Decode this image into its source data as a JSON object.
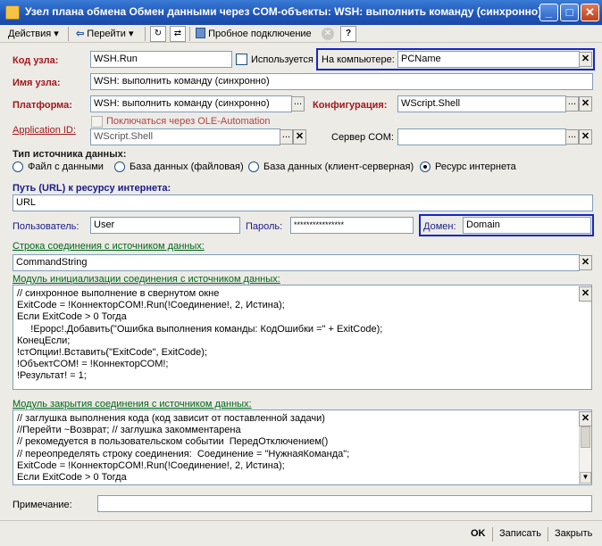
{
  "window": {
    "title": "Узел плана обмена Обмен данными через COM-объекты: WSH: выполнить команду (синхронно)",
    "minimize": "_",
    "maximize": "□",
    "close": "✕"
  },
  "toolbar": {
    "actions": "Действия",
    "goto": "Перейти",
    "test_connection": "Пробное подключение",
    "help": "?"
  },
  "form": {
    "code_label": "Код узла:",
    "code_value": "WSH.Run",
    "used_label": "Используется",
    "computer_label": "На компьютере:",
    "computer_value": "PCName",
    "name_label": "Имя узла:",
    "name_value": "WSH: выполнить команду (синхронно)",
    "platform_label": "Платформа:",
    "platform_value": "WSH: выполнить команду (синхронно)",
    "config_label": "Конфигурация:",
    "config_value": "WScript.Shell",
    "appid_label": "Application ID:",
    "ole_label": "Поключаться через OLE-Automation",
    "appid_value": "WScript.Shell",
    "com_server_label": "Сервер COM:",
    "com_server_value": "",
    "source_type_label": "Тип источника данных:",
    "radio_file": "Файл с данными",
    "radio_db_file": "База данных (файловая)",
    "radio_db_cs": "База данных (клиент-серверная)",
    "radio_internet": "Ресурс интернета",
    "url_label": "Путь (URL) к ресурсу интернета:",
    "url_value": "URL",
    "user_label": "Пользователь:",
    "user_value": "User",
    "password_label": "Пароль:",
    "password_value": "****************",
    "domain_label": "Домен:",
    "domain_value": "Domain",
    "connstr_label": "Строка соединения с источником данных:",
    "connstr_value": "CommandString",
    "init_module_label": "Модуль инициализации соединения с источником данных:",
    "init_module_lines": [
      "// синхронное выполнение в свернутом окне",
      "ExitCode = !КоннекторCOM!.Run(!Соединение!, 2, Истина);",
      "Если ExitCode > 0 Тогда",
      "     !Ерорс!.Добавить(\"Ошибка выполнения команды: КодОшибки =\" + ExitCode);",
      "КонецЕсли;",
      "!стОпции!.Вставить(\"ExitCode\", ExitCode);",
      "!ОбъектCOM! = !КоннекторCOM!;",
      "!Результат! = 1;"
    ],
    "close_module_label": "Модуль закрытия соединения с источником данных:",
    "close_module_lines": [
      "// заглушка выполнения кода (код зависит от поставленной задачи)",
      "//Перейти ~Возврат; // заглушка закомментарена",
      "// рекомедуется в пользовательском событии  ПередОтключением()",
      "// переопределять строку соединения:  Соединение = \"НужнаяКоманда\";",
      "ExitCode = !КоннекторCOM!.Run(!Соединение!, 2, Истина);",
      "Если ExitCode > 0 Тогда"
    ],
    "note_label": "Примечание:",
    "note_value": ""
  },
  "bottom": {
    "ok": "OK",
    "save": "Записать",
    "close": "Закрыть"
  },
  "colors": {
    "highlight": "#1427c9",
    "required_label": "#a3171e",
    "section_label": "#00661a"
  }
}
